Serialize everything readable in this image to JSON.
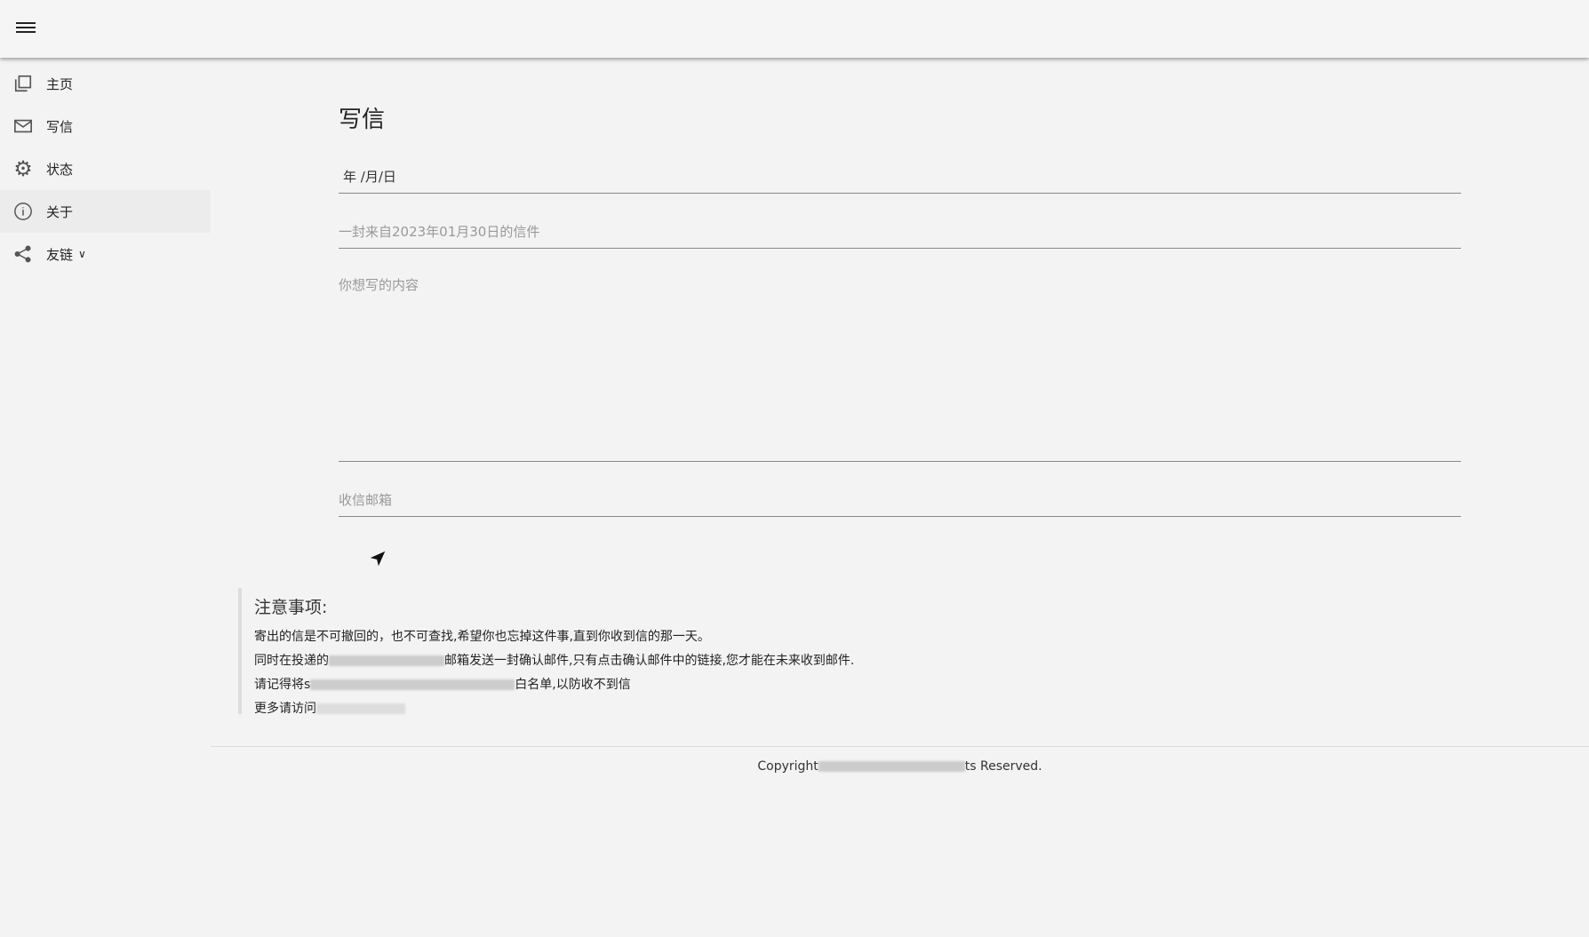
{
  "sidebar": {
    "items": [
      {
        "label": "主页",
        "icon": "copy-icon"
      },
      {
        "label": "写信",
        "icon": "mail-icon"
      },
      {
        "label": "状态",
        "icon": "gear-icon"
      },
      {
        "label": "关于",
        "icon": "info-icon"
      },
      {
        "label": "友链",
        "icon": "share-icon"
      }
    ]
  },
  "main": {
    "title": "写信",
    "date_value": "年 /月/日",
    "subject_placeholder": "一封来自2023年01月30日的信件",
    "content_placeholder": "你想写的内容",
    "email_placeholder": "收信邮箱"
  },
  "notice": {
    "heading": "注意事项:",
    "lines": [
      "寄出的信是不可撤回的，也不可查找,希望你也忘掉这件事,直到你收到信的那一天。",
      "同时在投递的",
      "邮箱发送一封确认邮件,只有点击确认邮件中的链接,您才能在未来收到邮件.",
      "请记得将s",
      "白名单,以防收不到信",
      "更多请访问"
    ]
  },
  "footer": {
    "left": "Copyright",
    "right": "ts Reserved."
  },
  "colors": {
    "background": "#f3f3f3",
    "text": "#222222"
  }
}
